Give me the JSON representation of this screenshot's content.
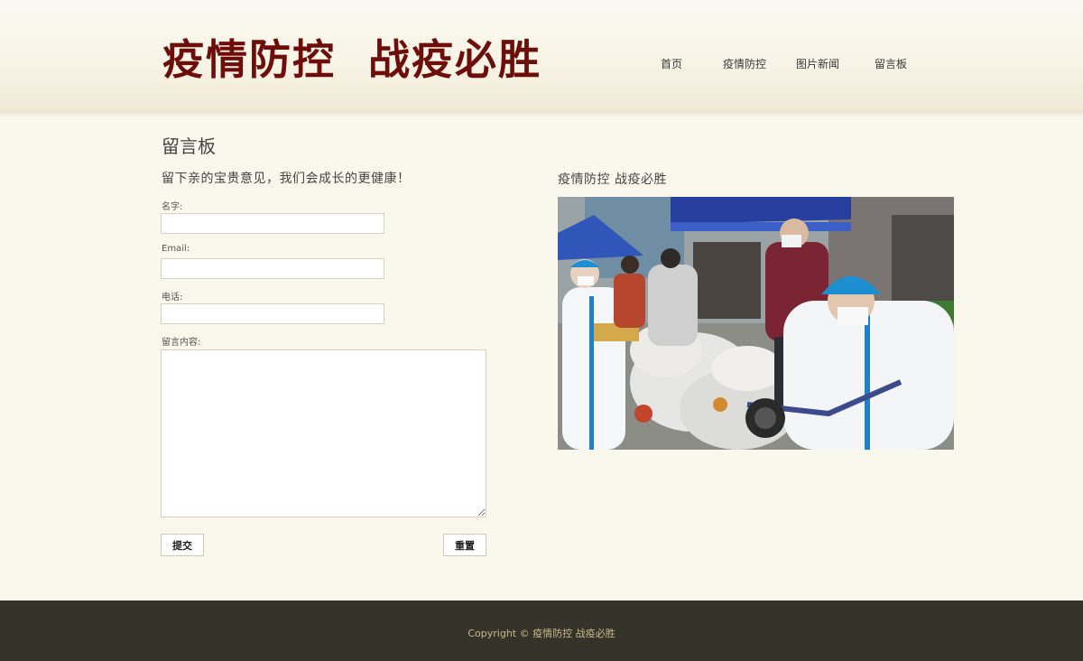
{
  "header": {
    "logo_text": "疫情防控  战疫必胜",
    "nav": [
      {
        "label": "首页"
      },
      {
        "label": "疫情防控"
      },
      {
        "label": "图片新闻"
      },
      {
        "label": "留言板"
      }
    ]
  },
  "main": {
    "page_title": "留言板",
    "form": {
      "subtitle": "留下亲的宝贵意见，我们会成长的更健康！",
      "name_label": "名字:",
      "name_value": "",
      "email_label": "Email:",
      "email_value": "",
      "phone_label": "电话:",
      "phone_value": "",
      "message_label": "留言内容:",
      "message_value": "",
      "submit_label": "提交",
      "reset_label": "重置"
    },
    "side": {
      "title": "疫情防控 战疫必胜"
    }
  },
  "footer": {
    "copyright": "Copyright © 疫情防控 战疫必胜"
  },
  "colors": {
    "logo": "#6e0e0a",
    "background": "#faf7ec",
    "footer": "#35322a",
    "footer_text": "#c8b98a"
  }
}
